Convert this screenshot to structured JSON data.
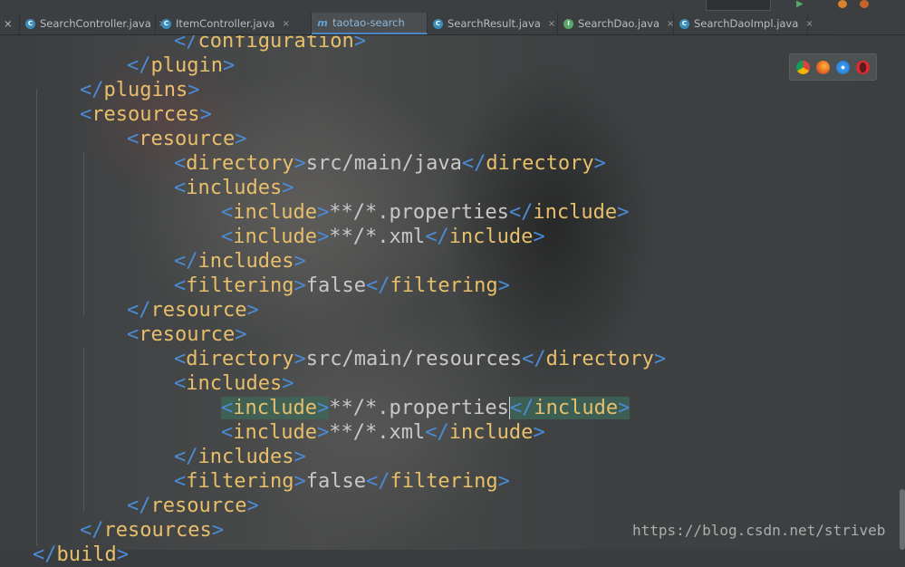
{
  "tabs": [
    {
      "label": "SearchController.java",
      "icon": "class-icon"
    },
    {
      "label": "ItemController.java",
      "icon": "class-icon"
    },
    {
      "label": "taotao-search",
      "icon": "maven-icon",
      "active": true
    },
    {
      "label": "SearchResult.java",
      "icon": "class-icon"
    },
    {
      "label": "SearchDao.java",
      "icon": "interface-icon"
    },
    {
      "label": "SearchDaoImpl.java",
      "icon": "class-icon"
    }
  ],
  "close_glyph": "×",
  "code_lines": [
    {
      "indent": 4,
      "kind": "close",
      "tag": "configuration"
    },
    {
      "indent": 3,
      "kind": "close",
      "tag": "plugin"
    },
    {
      "indent": 2,
      "kind": "close",
      "tag": "plugins"
    },
    {
      "indent": 2,
      "kind": "open",
      "tag": "resources"
    },
    {
      "indent": 3,
      "kind": "open",
      "tag": "resource"
    },
    {
      "indent": 4,
      "kind": "elem",
      "tag": "directory",
      "text": "src/main/java"
    },
    {
      "indent": 4,
      "kind": "open",
      "tag": "includes"
    },
    {
      "indent": 5,
      "kind": "elem",
      "tag": "include",
      "text": "**/*.properties"
    },
    {
      "indent": 5,
      "kind": "elem",
      "tag": "include",
      "text": "**/*.xml"
    },
    {
      "indent": 4,
      "kind": "close",
      "tag": "includes"
    },
    {
      "indent": 4,
      "kind": "elem",
      "tag": "filtering",
      "text": "false"
    },
    {
      "indent": 3,
      "kind": "close",
      "tag": "resource"
    },
    {
      "indent": 3,
      "kind": "open",
      "tag": "resource"
    },
    {
      "indent": 4,
      "kind": "elem",
      "tag": "directory",
      "text": "src/main/resources"
    },
    {
      "indent": 4,
      "kind": "open",
      "tag": "includes"
    },
    {
      "indent": 5,
      "kind": "elem",
      "tag": "include",
      "text": "**/*.properties",
      "highlight": true
    },
    {
      "indent": 5,
      "kind": "elem",
      "tag": "include",
      "text": "**/*.xml"
    },
    {
      "indent": 4,
      "kind": "close",
      "tag": "includes"
    },
    {
      "indent": 4,
      "kind": "elem",
      "tag": "filtering",
      "text": "false"
    },
    {
      "indent": 3,
      "kind": "close",
      "tag": "resource"
    },
    {
      "indent": 2,
      "kind": "close",
      "tag": "resources"
    },
    {
      "indent": 1,
      "kind": "close",
      "tag": "build"
    }
  ],
  "browser_icons": [
    "chrome-icon",
    "firefox-icon",
    "safari-icon",
    "opera-icon"
  ],
  "watermark": "https://blog.csdn.net/striveb",
  "colors": {
    "tag": "#e8bf6a",
    "bracket": "#4b8bd6",
    "text": "#c8c8c8",
    "active_tab": "#4a88c7"
  }
}
